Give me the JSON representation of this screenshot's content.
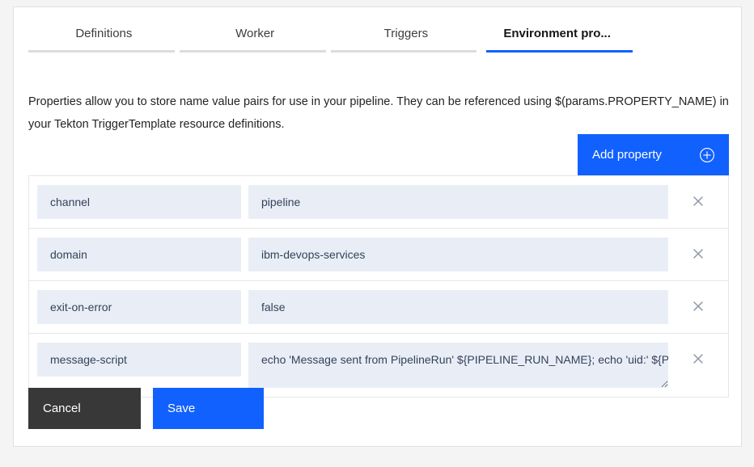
{
  "tabs": [
    {
      "label": "Definitions",
      "active": false
    },
    {
      "label": "Worker",
      "active": false
    },
    {
      "label": "Triggers",
      "active": false
    },
    {
      "label": "Environment pro...",
      "active": true
    }
  ],
  "description": {
    "text": "Properties allow you to store name value pairs for use in your pipeline. They can be referenced using $(params.PROPERTY_NAME) in your Tekton TriggerTemplate resource definitions."
  },
  "toolbar": {
    "add_property_label": "Add property",
    "add_property_icon": "plus-circle-icon"
  },
  "properties": [
    {
      "name": "channel",
      "value": "pipeline",
      "multiline": false,
      "delete_icon": "close-icon"
    },
    {
      "name": "domain",
      "value": "ibm-devops-services",
      "multiline": false,
      "delete_icon": "close-icon"
    },
    {
      "name": "exit-on-error",
      "value": "false",
      "multiline": false,
      "delete_icon": "close-icon"
    },
    {
      "name": "message-script",
      "value": "echo 'Message sent from PipelineRun' ${PIPELINE_RUN_NAME}; echo 'uid:' ${P",
      "multiline": true,
      "delete_icon": "close-icon"
    }
  ],
  "footer": {
    "cancel_label": "Cancel",
    "save_label": "Save"
  },
  "colors": {
    "accent_blue": "#1161fe",
    "cancel_dark": "#383838",
    "field_fill": "#e9eef6",
    "page_background": "#f4f4f4",
    "tab_inactive_underline": "#dcdcdc"
  }
}
